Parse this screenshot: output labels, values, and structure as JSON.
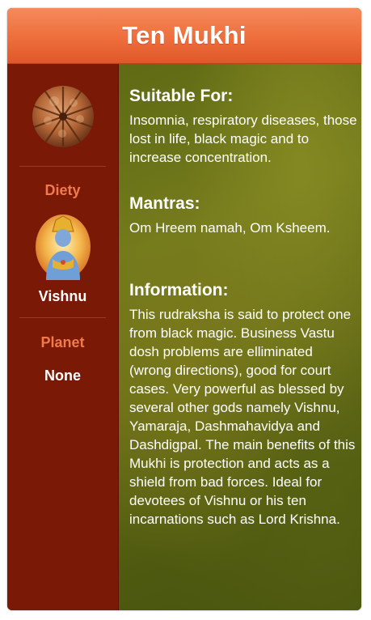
{
  "header": {
    "title": "Ten Mukhi"
  },
  "sidebar": {
    "bead_icon": "rudraksha-bead-icon",
    "deity_label": "Diety",
    "deity_image": "vishnu-portrait",
    "deity_name": "Vishnu",
    "planet_label": "Planet",
    "planet_value": "None"
  },
  "main": {
    "suitable": {
      "heading": "Suitable For:",
      "text": "Insomnia, respiratory diseases, those lost in life, black magic and to increase concentration."
    },
    "mantras": {
      "heading": "Mantras:",
      "text": "Om Hreem namah, Om Ksheem."
    },
    "information": {
      "heading": "Information:",
      "text": "This rudraksha is said to protect one from black magic. Business Vastu dosh problems are elliminated (wrong directions), good for court cases. Very powerful as blessed by several other gods namely Vishnu, Yamaraja, Dashmahavidya and Dashdigpal. The main benefits of this Mukhi is protection and acts as a shield from bad forces. Ideal for devotees of Vishnu or his ten incarnations such as Lord Krishna."
    }
  },
  "colors": {
    "header": "#ee6e3c",
    "sidebar": "#7a1906",
    "side_label": "#f07a4c",
    "main_bg": "#6a6f18"
  }
}
